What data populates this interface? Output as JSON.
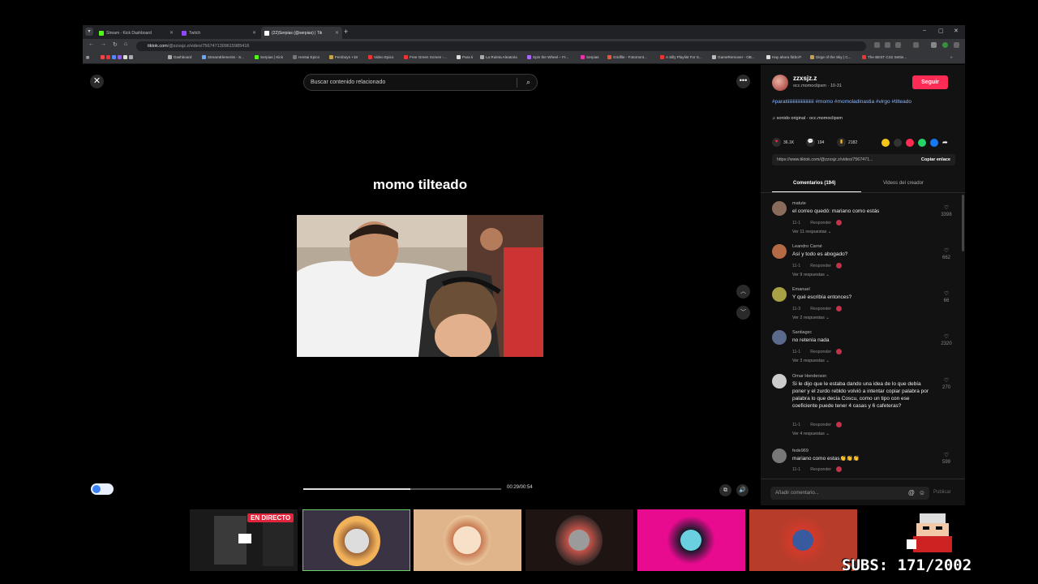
{
  "browser": {
    "tabs": [
      {
        "title": "Stream - Kick Dashboard",
        "color": "#53fc18"
      },
      {
        "title": "Twitch",
        "color": "#9146ff"
      },
      {
        "title": "(22)Serpias (@serpias) | Tik",
        "color": "#ffffff"
      }
    ],
    "url_host": "tiktok.com",
    "url_path": "/@zzxsjz.z/video/7567471309615985416",
    "bookmarks": [
      "Dashboard",
      "StreamElements - S...",
      "Serpias | Kick",
      "Hentai Epico",
      "Femboys +18",
      "Video Epico",
      "Free Green Screen -...",
      "Para ti",
      "La Ruleta Aleatoria",
      "Spin the Wheel – Fr...",
      "Serpias",
      "Gridfile - Fotomont...",
      "A Silly Playlist For S...",
      "GameRemover - OB...",
      "Hay ahora fútbol?",
      "Dirge of the Sky | C...",
      "The BEST CS2 Settin..."
    ]
  },
  "video": {
    "search_placeholder": "Buscar contenido relacionado",
    "caption": "momo tilteado",
    "time": "00:29/00:54",
    "progress": 0.54
  },
  "panel": {
    "username": "zzxsjz.z",
    "subline": "occ.momoclipsm · 10-31",
    "follow": "Seguir",
    "hashtags": "#paratiiiiiiiiiiiiiiiiiiiiiii #momo #momoladinastia #virgo #tilteado",
    "sound": "sonido original - occ.momoclipsm",
    "likes": "36.1K",
    "comments_count": "194",
    "saves": "2182",
    "link": "https://www.tiktok.com/@zzxsjz.z/video/7567471...",
    "copy_link": "Copiar enlace",
    "tab_comments": "Comentarios (194)",
    "tab_creator": "Videos del creador",
    "comment_placeholder": "Añadir comentario...",
    "publish": "Publicar"
  },
  "comments": [
    {
      "author": "matute",
      "text": "el correo quedó: mariano como estás",
      "date": "11-1",
      "reply": "Responder",
      "more": "Ver 11 respuestas",
      "likes": "3398"
    },
    {
      "author": "Leandro Carné",
      "text": "Así y todo es abogado?",
      "date": "11-1",
      "reply": "Responder",
      "more": "Ver 9 respuestas",
      "likes": "662"
    },
    {
      "author": "Emanuel",
      "text": "Y qué escribía entonces?",
      "date": "11-3",
      "reply": "Responder",
      "more": "Ver 2 respuestas",
      "likes": "66"
    },
    {
      "author": "Santiagxc",
      "text": "no retenía nada",
      "date": "11-1",
      "reply": "Responder",
      "more": "Ver 3 respuestas",
      "likes": "2320"
    },
    {
      "author": "Omar Henderson",
      "text": "Si le dijo que le estaba dando una idea de lo que debía poner y el zurdo rebldo volvió a intentar copiar palabra por palabra lo que decía Coscu, como un tipo con ese coeficiente puede tener 4 casas y 6 cafeteras?",
      "date": "11-1",
      "reply": "Responder",
      "more": "Ver 4 respuestas",
      "likes": "270"
    },
    {
      "author": "fede969",
      "text": "mariano como estas👏👏👏",
      "date": "11-1",
      "reply": "Responder",
      "more": "",
      "likes": "599"
    }
  ],
  "overlay": {
    "live_badge": "EN DIRECTO",
    "subs": "SUBS: 171/2002"
  },
  "colors": {
    "accent": "#fe2c55",
    "hashtag": "#8fb8ff"
  }
}
